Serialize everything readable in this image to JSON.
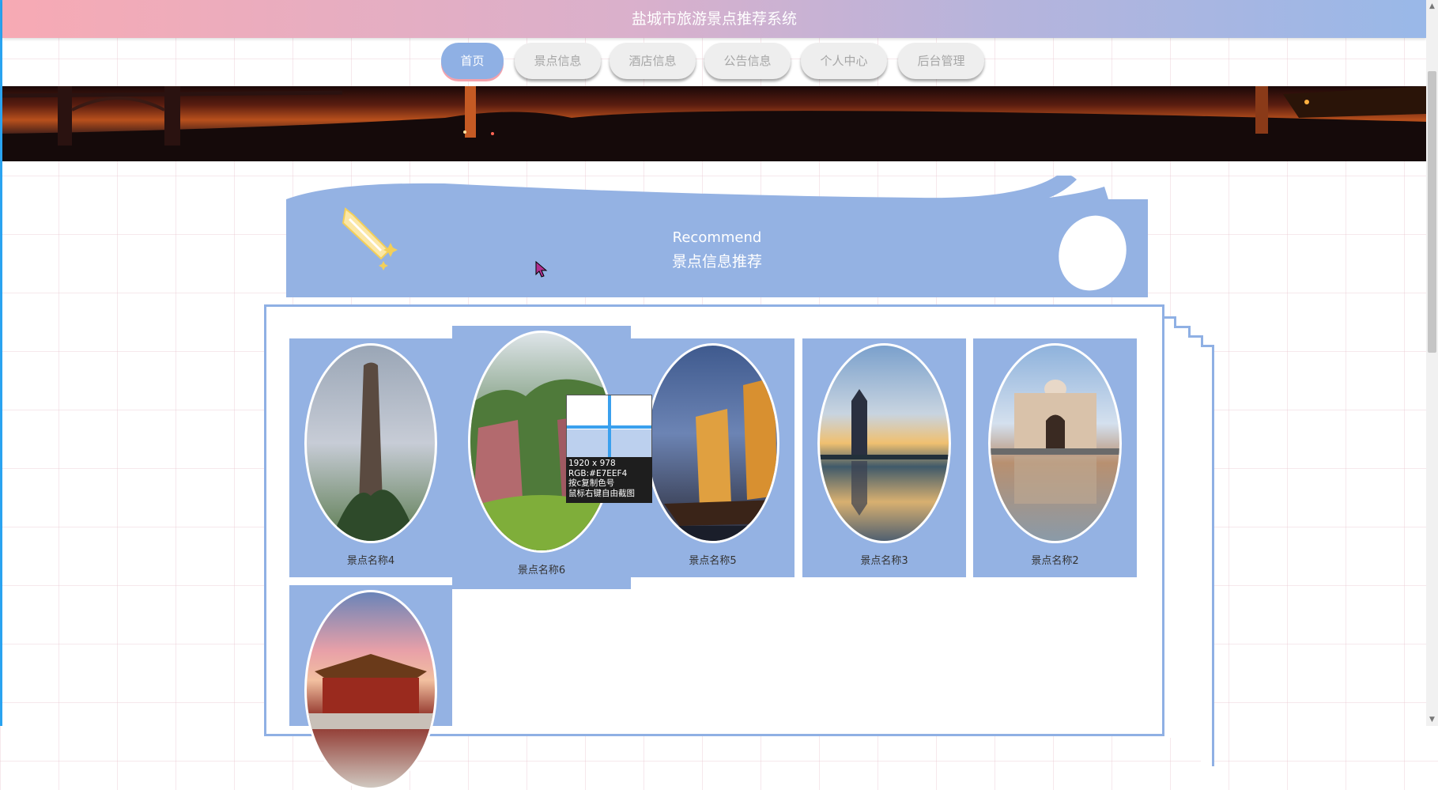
{
  "app": {
    "title": "盐城市旅游景点推荐系统"
  },
  "nav": {
    "items": [
      {
        "label": "首页",
        "active": true
      },
      {
        "label": "景点信息",
        "active": false
      },
      {
        "label": "酒店信息",
        "active": false
      },
      {
        "label": "公告信息",
        "active": false
      },
      {
        "label": "个人中心",
        "active": false
      },
      {
        "label": "后台管理",
        "active": false
      }
    ]
  },
  "recommend": {
    "title_en": "Recommend",
    "title_zh": "景点信息推荐",
    "items": [
      {
        "name": "景点名称4",
        "photo": "stone-totem-pillar"
      },
      {
        "name": "景点名称6",
        "photo": "mountain-canyon"
      },
      {
        "name": "景点名称5",
        "photo": "sailing-junk-boat"
      },
      {
        "name": "景点名称3",
        "photo": "pagoda-reflection"
      },
      {
        "name": "景点名称2",
        "photo": "domed-palace"
      },
      {
        "name": "",
        "photo": "forbidden-city-gate"
      }
    ]
  },
  "color_picker": {
    "size": "1920 x 978",
    "rgb": "RGB:#E7EEF4",
    "hint_copy": "按c复制色号",
    "hint_screenshot": "鼠标右键自由截图"
  },
  "colors": {
    "accent": "#8fb0e4",
    "card": "#94b2e3",
    "nav_inactive": "#eeeeee",
    "nav_active_underline": "#f4a2ac"
  }
}
